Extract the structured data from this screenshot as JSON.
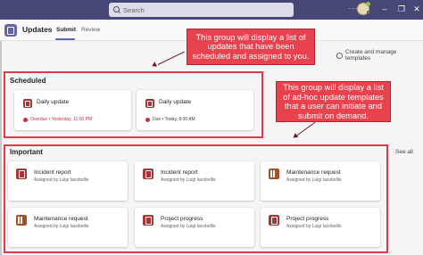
{
  "topbar": {
    "search_placeholder": "Search"
  },
  "header": {
    "app_title": "Updates",
    "tabs": [
      "Submit",
      "Review"
    ]
  },
  "create_manage": "Create and manage templates",
  "sections": {
    "scheduled": {
      "title": "Scheduled",
      "cards": [
        {
          "title": "Daily update",
          "status": "Overdue • Yesterday, 11:00 PM"
        },
        {
          "title": "Daily update",
          "status": "Due • Today, 8:00 AM"
        }
      ]
    },
    "important": {
      "title": "Important",
      "see_all": "See all",
      "cards": [
        {
          "title": "Incident report",
          "subtitle": "Assigned by Luigi Iacobellis",
          "icon": "report-icon"
        },
        {
          "title": "Incident report",
          "subtitle": "Assigned by Luigi Iacobellis",
          "icon": "report-icon"
        },
        {
          "title": "Maintenance request",
          "subtitle": "Assigned by Luigi Iacobellis",
          "icon": "tools-icon"
        },
        {
          "title": "Maintenance request",
          "subtitle": "Assigned by Luigi Iacobellis",
          "icon": "tools-icon"
        },
        {
          "title": "Project progress",
          "subtitle": "Assigned by Luigi Iacobellis",
          "icon": "report-icon"
        },
        {
          "title": "Project progress",
          "subtitle": "Assigned by Luigi Iacobellis",
          "icon": "report-icon"
        }
      ]
    }
  },
  "annotations": {
    "scheduled": "This group will display a list of updates that have been scheduled and assigned to you.",
    "important": "This group will display a list of ad-hoc update templates that a user can initiate and submit on demand."
  },
  "colors": {
    "accent": "#6264a7",
    "topbar": "#464775",
    "annotation": "#e8424e",
    "icon_red": "#a4373a"
  }
}
